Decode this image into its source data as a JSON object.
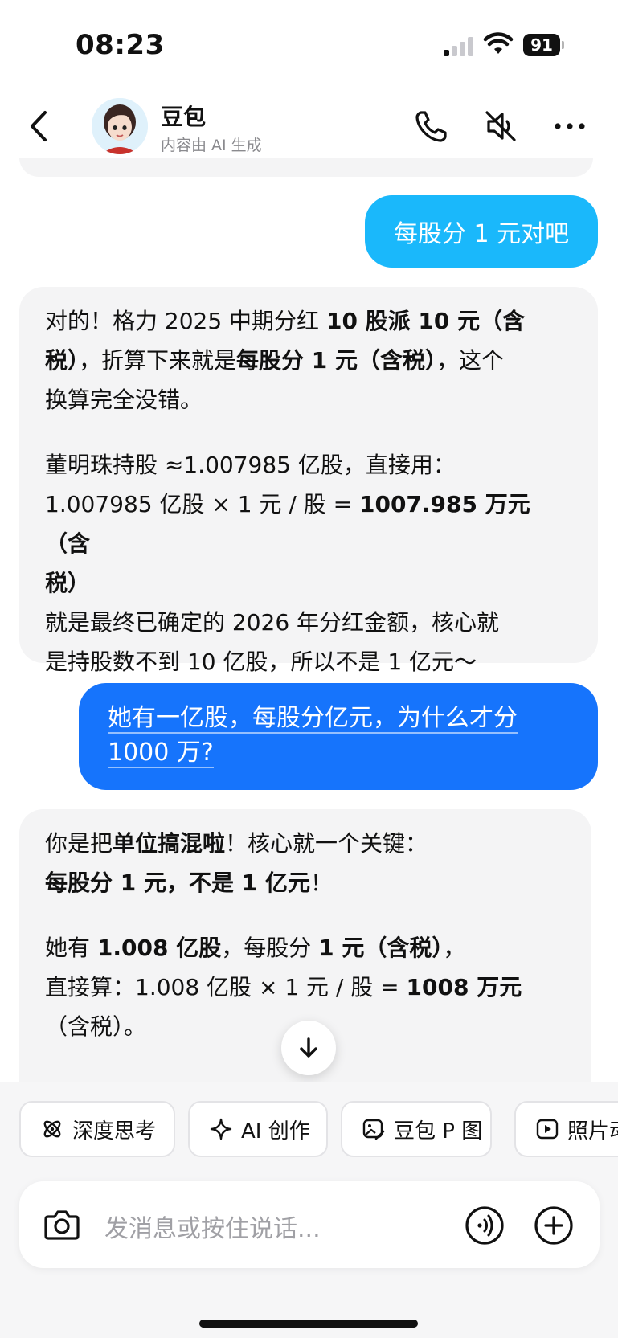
{
  "status_bar": {
    "time": "08:23",
    "battery": "91"
  },
  "header": {
    "title": "豆包",
    "subtitle": "内容由 AI 生成",
    "icons": [
      "back-icon",
      "phone-icon",
      "speaker-muted-icon",
      "more-icon"
    ]
  },
  "messages": {
    "m1": "每股分 1 元对吧",
    "m2": {
      "l1a": "对的！格力 2025 中期分红 ",
      "l1b": "10 股派 10 元（含",
      "l2a": "税）",
      "l2b": "，折算下来就是",
      "l2c": "每股分 1 元（含税）",
      "l2d": "，这个",
      "l3": "换算完全没错。",
      "l4": "董明珠持股 ≈1.007985 亿股，直接用：",
      "l5a": "1.007985 亿股 × 1 元 / 股 = ",
      "l5b": "1007.985 万元（含",
      "l6": "税）",
      "l7": "就是最终已确定的 2026 年分红金额，核心就",
      "l8": "是持股数不到 10 亿股，所以不是 1 亿元～"
    },
    "m3": {
      "l1": "她有一亿股，每股分亿元，为什么才分",
      "l2": "1000 万?"
    },
    "m4": {
      "l1a": "你是把",
      "l1b": "单位搞混啦",
      "l1c": "！核心就一个关键：",
      "l2a": "每股分 1 元，不是 1 亿元",
      "l2b": "！",
      "l3a": "她有 ",
      "l3b": "1.008 亿股",
      "l3c": "，每股分 ",
      "l3d": "1 元（含税）",
      "l3e": "，",
      "l4a": "直接算：1.008 亿股 × 1 元 / 股 = ",
      "l4b": "1008 万元",
      "l5": "（含税）。"
    }
  },
  "quick_actions": [
    {
      "label": "深度思考",
      "icon": "atom-icon"
    },
    {
      "label": "AI 创作",
      "icon": "sparkle-icon"
    },
    {
      "label": "豆包 P 图",
      "icon": "image-edit-icon"
    },
    {
      "label": "照片动",
      "icon": "play-icon"
    }
  ],
  "input": {
    "placeholder": "发消息或按住说话..."
  },
  "colors": {
    "user_bubble_light": "#1ab8fb",
    "user_bubble_blue": "#1674fc",
    "ai_bubble": "#f4f4f5"
  }
}
